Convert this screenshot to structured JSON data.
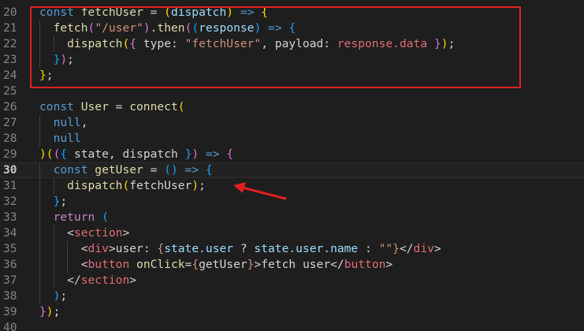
{
  "editor": {
    "active_line": 30,
    "lines": [
      {
        "num": "20",
        "tokens": [
          [
            "kw",
            "const "
          ],
          [
            "fn",
            "fetchUser"
          ],
          [
            "plain",
            " = "
          ],
          [
            "br1",
            "("
          ],
          [
            "var",
            "dispatch"
          ],
          [
            "br1",
            ")"
          ],
          [
            "kw",
            " => "
          ],
          [
            "br1",
            "{"
          ]
        ]
      },
      {
        "num": "21",
        "tokens": [
          [
            "plain",
            "  "
          ],
          [
            "fn",
            "fetch"
          ],
          [
            "br2",
            "("
          ],
          [
            "str",
            "\"/user\""
          ],
          [
            "br2",
            ")"
          ],
          [
            "plain",
            "."
          ],
          [
            "fn",
            "then"
          ],
          [
            "br2",
            "("
          ],
          [
            "br3",
            "("
          ],
          [
            "var",
            "response"
          ],
          [
            "br3",
            ")"
          ],
          [
            "kw",
            " => "
          ],
          [
            "br3",
            "{"
          ]
        ]
      },
      {
        "num": "22",
        "tokens": [
          [
            "plain",
            "    "
          ],
          [
            "fn",
            "dispatch"
          ],
          [
            "br1",
            "("
          ],
          [
            "br2",
            "{"
          ],
          [
            "plain",
            " type: "
          ],
          [
            "str",
            "\"fetchUser\""
          ],
          [
            "plain",
            ", payload: "
          ],
          [
            "prop",
            "response.data"
          ],
          [
            "plain",
            " "
          ],
          [
            "br2",
            "}"
          ],
          [
            "br1",
            ")"
          ],
          [
            "plain",
            ";"
          ]
        ]
      },
      {
        "num": "23",
        "tokens": [
          [
            "plain",
            "  "
          ],
          [
            "br3",
            "}"
          ],
          [
            "br2",
            ")"
          ],
          [
            "plain",
            ";"
          ]
        ]
      },
      {
        "num": "24",
        "tokens": [
          [
            "br1",
            "}"
          ],
          [
            "plain",
            ";"
          ]
        ]
      },
      {
        "num": "25",
        "tokens": []
      },
      {
        "num": "26",
        "tokens": [
          [
            "kw",
            "const "
          ],
          [
            "fn",
            "User"
          ],
          [
            "plain",
            " = "
          ],
          [
            "fn",
            "connect"
          ],
          [
            "br1",
            "("
          ]
        ]
      },
      {
        "num": "27",
        "tokens": [
          [
            "plain",
            "  "
          ],
          [
            "kw",
            "null"
          ],
          [
            "plain",
            ","
          ]
        ]
      },
      {
        "num": "28",
        "tokens": [
          [
            "plain",
            "  "
          ],
          [
            "kw",
            "null"
          ]
        ]
      },
      {
        "num": "29",
        "tokens": [
          [
            "br1",
            ")"
          ],
          [
            "br1",
            "("
          ],
          [
            "br2",
            "("
          ],
          [
            "br3",
            "{"
          ],
          [
            "plain",
            " state, dispatch "
          ],
          [
            "br3",
            "}"
          ],
          [
            "br2",
            ")"
          ],
          [
            "kw",
            " => "
          ],
          [
            "br2",
            "{"
          ]
        ]
      },
      {
        "num": "30",
        "tokens": [
          [
            "plain",
            "  "
          ],
          [
            "kw",
            "const "
          ],
          [
            "fn",
            "getUser"
          ],
          [
            "plain",
            " = "
          ],
          [
            "br3",
            "("
          ],
          [
            "br3",
            ")"
          ],
          [
            "kw",
            " => "
          ],
          [
            "br3",
            "{"
          ]
        ]
      },
      {
        "num": "31",
        "tokens": [
          [
            "plain",
            "    "
          ],
          [
            "fn",
            "dispatch"
          ],
          [
            "br1",
            "("
          ],
          [
            "plain",
            "fetchUser"
          ],
          [
            "br1",
            ")"
          ],
          [
            "plain",
            ";"
          ]
        ]
      },
      {
        "num": "32",
        "tokens": [
          [
            "plain",
            "  "
          ],
          [
            "br3",
            "}"
          ],
          [
            "plain",
            ";"
          ]
        ]
      },
      {
        "num": "33",
        "tokens": [
          [
            "plain",
            "  "
          ],
          [
            "ctl",
            "return"
          ],
          [
            "plain",
            " "
          ],
          [
            "br3",
            "("
          ]
        ]
      },
      {
        "num": "34",
        "tokens": [
          [
            "plain",
            "    "
          ],
          [
            "punc",
            "<"
          ],
          [
            "tagname",
            "section"
          ],
          [
            "punc",
            ">"
          ]
        ]
      },
      {
        "num": "35",
        "tokens": [
          [
            "plain",
            "      "
          ],
          [
            "punc",
            "<"
          ],
          [
            "tagname",
            "div"
          ],
          [
            "punc",
            ">"
          ],
          [
            "plain",
            "user: "
          ],
          [
            "str",
            "{"
          ],
          [
            "obj",
            "state.user"
          ],
          [
            "plain",
            " ? "
          ],
          [
            "obj",
            "state.user.name"
          ],
          [
            "plain",
            " : "
          ],
          [
            "str",
            "\"\""
          ],
          [
            "str",
            "}"
          ],
          [
            "punc",
            "</"
          ],
          [
            "tagname",
            "div"
          ],
          [
            "punc",
            ">"
          ]
        ]
      },
      {
        "num": "36",
        "tokens": [
          [
            "plain",
            "      "
          ],
          [
            "punc",
            "<"
          ],
          [
            "tagname",
            "button"
          ],
          [
            "plain",
            " "
          ],
          [
            "fn",
            "onClick"
          ],
          [
            "plain",
            "="
          ],
          [
            "str",
            "{"
          ],
          [
            "plain",
            "getUser"
          ],
          [
            "str",
            "}"
          ],
          [
            "punc",
            ">"
          ],
          [
            "plain",
            "fetch user"
          ],
          [
            "punc",
            "</"
          ],
          [
            "tagname",
            "button"
          ],
          [
            "punc",
            ">"
          ]
        ]
      },
      {
        "num": "37",
        "tokens": [
          [
            "plain",
            "    "
          ],
          [
            "punc",
            "</"
          ],
          [
            "tagname",
            "section"
          ],
          [
            "punc",
            ">"
          ]
        ]
      },
      {
        "num": "38",
        "tokens": [
          [
            "plain",
            "  "
          ],
          [
            "br3",
            ")"
          ],
          [
            "plain",
            ";"
          ]
        ]
      },
      {
        "num": "39",
        "tokens": [
          [
            "br2",
            "}"
          ],
          [
            "br1",
            ")"
          ],
          [
            "plain",
            ";"
          ]
        ]
      },
      {
        "num": "40",
        "tokens": []
      }
    ]
  },
  "annotations": {
    "box_color": "#e02020",
    "arrow_color": "#e02020"
  }
}
